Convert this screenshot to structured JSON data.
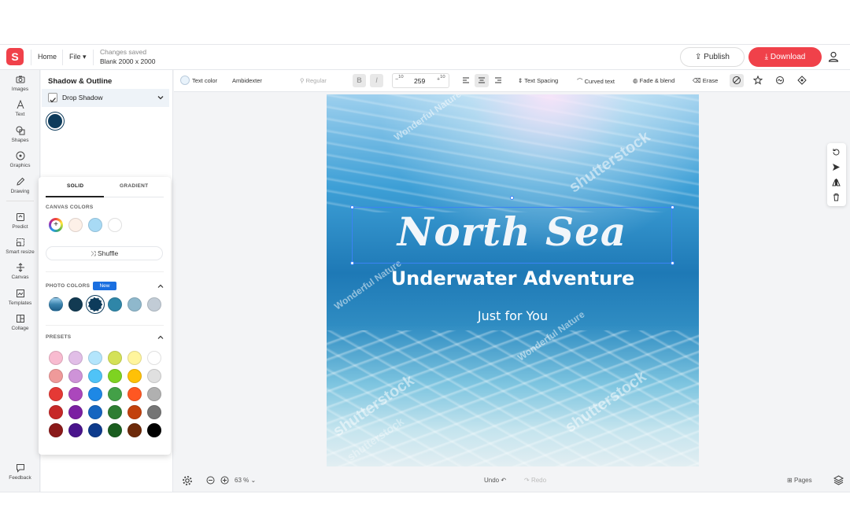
{
  "header": {
    "logo_letter": "S",
    "home": "Home",
    "file": "File",
    "status": "Changes saved",
    "canvas_size": "Blank 2000 x 2000",
    "publish": "Publish",
    "download": "Download",
    "accent": "#f0414a"
  },
  "rail": {
    "items": [
      {
        "label": "Images",
        "icon": "camera-icon"
      },
      {
        "label": "Text",
        "icon": "text-icon"
      },
      {
        "label": "Shapes",
        "icon": "shapes-icon"
      },
      {
        "label": "Graphics",
        "icon": "graphics-icon"
      },
      {
        "label": "Drawing",
        "icon": "pencil-icon"
      },
      {
        "label": "Predict",
        "icon": "predict-icon"
      },
      {
        "label": "Smart resize",
        "icon": "resize-icon"
      },
      {
        "label": "Canvas",
        "icon": "canvas-icon"
      },
      {
        "label": "Templates",
        "icon": "templates-icon"
      },
      {
        "label": "Collage",
        "icon": "collage-icon"
      }
    ],
    "feedback": "Feedback"
  },
  "panel": {
    "title": "Shadow & Outline",
    "drop_shadow": "Drop Shadow",
    "drop_shadow_checked": true,
    "shadow_color": "#0d3b5b"
  },
  "color_popup": {
    "tab_solid": "SOLID",
    "tab_gradient": "GRADIENT",
    "canvas_colors_label": "CANVAS COLORS",
    "canvas_colors": [
      "#fdf0e8",
      "#a8daf5",
      "#ffffff"
    ],
    "shuffle": "Shuffle",
    "photo_colors_label": "PHOTO COLORS",
    "new_badge": "New",
    "photo_colors": [
      "#3a82ad",
      "#123a52",
      "#0d3b5b",
      "#2f86a8",
      "#8fb8cc",
      "#c2ccd6"
    ],
    "presets_label": "PRESETS",
    "presets": [
      [
        "#f8bbd0",
        "#e1bee7",
        "#b3e5fc",
        "#d4e157",
        "#fff59d",
        "#ffffff"
      ],
      [
        "#ef9a9a",
        "#ce93d8",
        "#4fc3f7",
        "#7ed321",
        "#ffc107",
        "#e0e0e0"
      ],
      [
        "#e53935",
        "#ab47bc",
        "#1e88e5",
        "#43a047",
        "#ff5722",
        "#b0b0b0"
      ],
      [
        "#c62828",
        "#7b1fa2",
        "#1565c0",
        "#2e7d32",
        "#c2410c",
        "#757575"
      ],
      [
        "#8b1a1a",
        "#4a148c",
        "#0d3b8c",
        "#1b5e20",
        "#6d2a0a",
        "#000000"
      ]
    ]
  },
  "toolbar": {
    "text_color": "Text color",
    "font": "Ambidexter",
    "weight": "Regular",
    "bold": "B",
    "italic": "I",
    "dec": "10",
    "font_size": "259",
    "inc": "10",
    "text_spacing": "Text Spacing",
    "curved_text": "Curved text",
    "fade_blend": "Fade & blend",
    "erase": "Erase"
  },
  "design": {
    "title": "North Sea",
    "subtitle": "Underwater Adventure",
    "tagline": "Just for You",
    "watermark_1": "Wonderful Nature",
    "watermark_2": "shutterstock",
    "watermark_3": "Wonderful Nature",
    "watermark_4": "shutterstock",
    "watermark_5": "Wonderful Nature",
    "watermark_6": "shutterstock",
    "watermark_7": "shutterstock"
  },
  "bottom": {
    "zoom": "63 %",
    "undo": "Undo",
    "redo": "Redo",
    "pages": "Pages"
  }
}
